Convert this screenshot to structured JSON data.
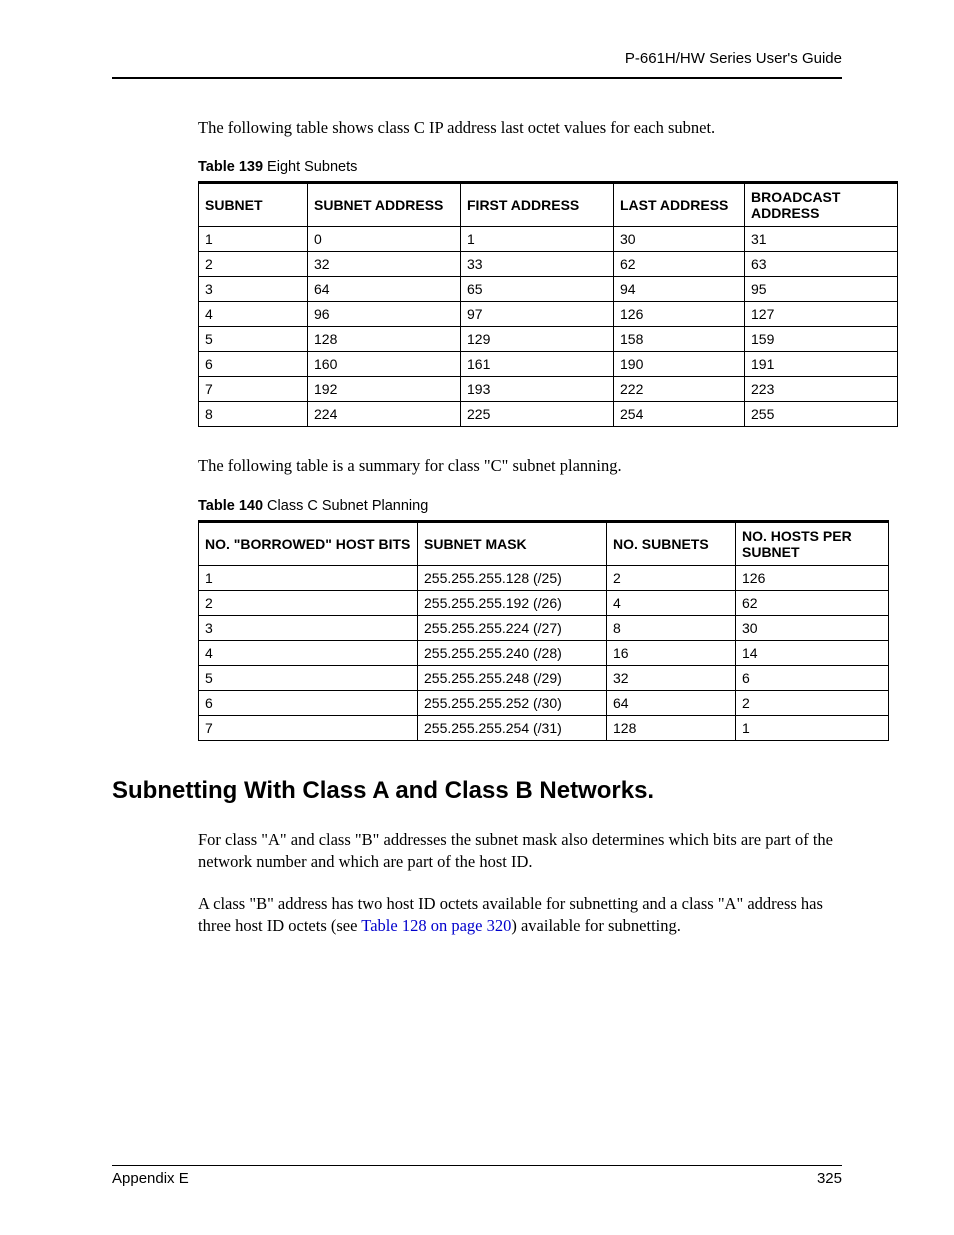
{
  "header_title": "P-661H/HW Series User's Guide",
  "intro_139": "The following table shows class C IP address last octet values for each subnet.",
  "caption_139_bold": "Table 139",
  "caption_139_rest": "   Eight Subnets",
  "table_139": {
    "headers": [
      "SUBNET",
      "SUBNET ADDRESS",
      "FIRST ADDRESS",
      "LAST ADDRESS",
      "BROADCAST ADDRESS"
    ],
    "rows": [
      [
        "1",
        "0",
        "1",
        "30",
        "31"
      ],
      [
        "2",
        "32",
        "33",
        "62",
        "63"
      ],
      [
        "3",
        "64",
        "65",
        "94",
        "95"
      ],
      [
        "4",
        "96",
        "97",
        "126",
        "127"
      ],
      [
        "5",
        "128",
        "129",
        "158",
        "159"
      ],
      [
        "6",
        "160",
        "161",
        "190",
        "191"
      ],
      [
        "7",
        "192",
        "193",
        "222",
        "223"
      ],
      [
        "8",
        "224",
        "225",
        "254",
        "255"
      ]
    ]
  },
  "intro_140": "The following table is a summary for class \"C\" subnet planning.",
  "caption_140_bold": "Table 140",
  "caption_140_rest": "   Class C Subnet Planning",
  "table_140": {
    "headers": [
      "NO. \"BORROWED\" HOST BITS",
      "SUBNET MASK",
      "NO. SUBNETS",
      "NO. HOSTS PER SUBNET"
    ],
    "rows": [
      [
        "1",
        "255.255.255.128 (/25)",
        "2",
        "126"
      ],
      [
        "2",
        "255.255.255.192 (/26)",
        "4",
        "62"
      ],
      [
        "3",
        "255.255.255.224 (/27)",
        "8",
        "30"
      ],
      [
        "4",
        "255.255.255.240 (/28)",
        "16",
        "14"
      ],
      [
        "5",
        "255.255.255.248 (/29)",
        "32",
        "6"
      ],
      [
        "6",
        "255.255.255.252 (/30)",
        "64",
        "2"
      ],
      [
        "7",
        "255.255.255.254 (/31)",
        "128",
        "1"
      ]
    ]
  },
  "section_heading": "Subnetting With Class A and Class B Networks.",
  "para1": "For class \"A\" and class \"B\" addresses the subnet mask also determines which bits are part of the network number and which are part of the host ID.",
  "para2_pre": "A class \"B\" address has two host ID octets available for subnetting and a class \"A\" address has three host ID octets (see ",
  "para2_link": "Table 128 on page 320",
  "para2_post": ") available for subnetting.",
  "footer_left": "Appendix E",
  "footer_right": "325"
}
